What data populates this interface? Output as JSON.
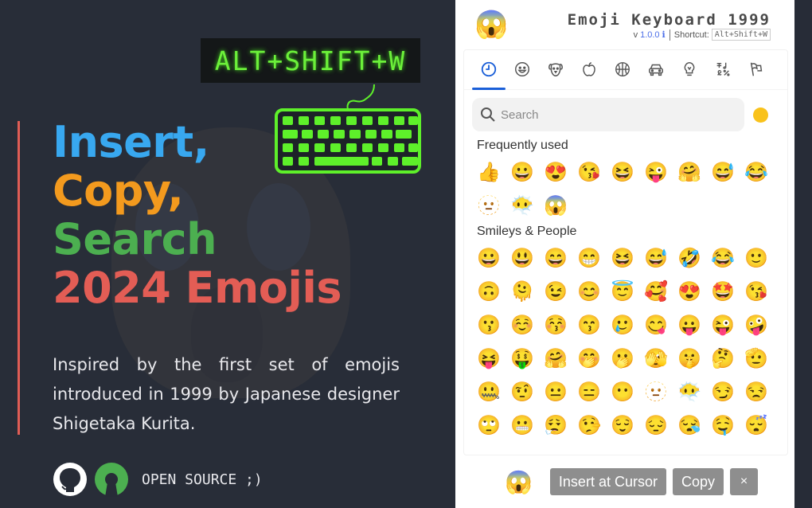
{
  "promo": {
    "shortcut_display": "ALT+SHIFT+W",
    "headline": [
      "Insert,",
      "Copy,",
      "Search",
      "2024 Emojis"
    ],
    "tagline": "Inspired by the first set of emojis introduced in 1999 by Japanese designer Shigetaka Kurita.",
    "open_source_label": "OPEN SOURCE ;)",
    "colors": {
      "insert": "#38a8f0",
      "copy": "#f39a1e",
      "search": "#4caf50",
      "emojis": "#e35d55",
      "keyboard": "#5ef02a"
    }
  },
  "panel": {
    "logo_emoji": "😱",
    "title": "Emoji Keyboard 1999",
    "version_prefix": "v",
    "version": "1.0.0",
    "info_icon": "ℹ",
    "shortcut_label": "Shortcut:",
    "shortcut": "Alt+Shift+W",
    "categories": [
      {
        "name": "recent",
        "active": true
      },
      {
        "name": "smileys"
      },
      {
        "name": "animals"
      },
      {
        "name": "food"
      },
      {
        "name": "activity"
      },
      {
        "name": "travel"
      },
      {
        "name": "objects"
      },
      {
        "name": "symbols"
      },
      {
        "name": "flags"
      }
    ],
    "search_placeholder": "Search",
    "skin_tone_color": "#f9c21b",
    "sections": [
      {
        "label": "Frequently used",
        "emojis": [
          "👍",
          "😀",
          "😍",
          "😘",
          "😆",
          "😜",
          "🤗",
          "😅",
          "😂",
          "🫥",
          "😶‍🌫️",
          "😱"
        ]
      },
      {
        "label": "Smileys & People",
        "emojis": [
          "😀",
          "😃",
          "😄",
          "😁",
          "😆",
          "😅",
          "🤣",
          "😂",
          "🙂",
          "🙃",
          "🫠",
          "😉",
          "😊",
          "😇",
          "🥰",
          "😍",
          "🤩",
          "😘",
          "😗",
          "☺️",
          "😚",
          "😙",
          "🥲",
          "😋",
          "😛",
          "😜",
          "🤪",
          "😝",
          "🤑",
          "🤗",
          "🤭",
          "🫢",
          "🫣",
          "🤫",
          "🤔",
          "🫡",
          "🤐",
          "🤨",
          "😐",
          "😑",
          "😶",
          "🫥",
          "😶‍🌫️",
          "😏",
          "😒",
          "🙄",
          "😬",
          "😮‍💨",
          "🤥",
          "😌",
          "😔",
          "😪",
          "🤤",
          "😴"
        ]
      }
    ],
    "footer": {
      "preview_emoji": "😱",
      "insert_label": "Insert at Cursor",
      "copy_label": "Copy",
      "close_label": "×"
    }
  }
}
